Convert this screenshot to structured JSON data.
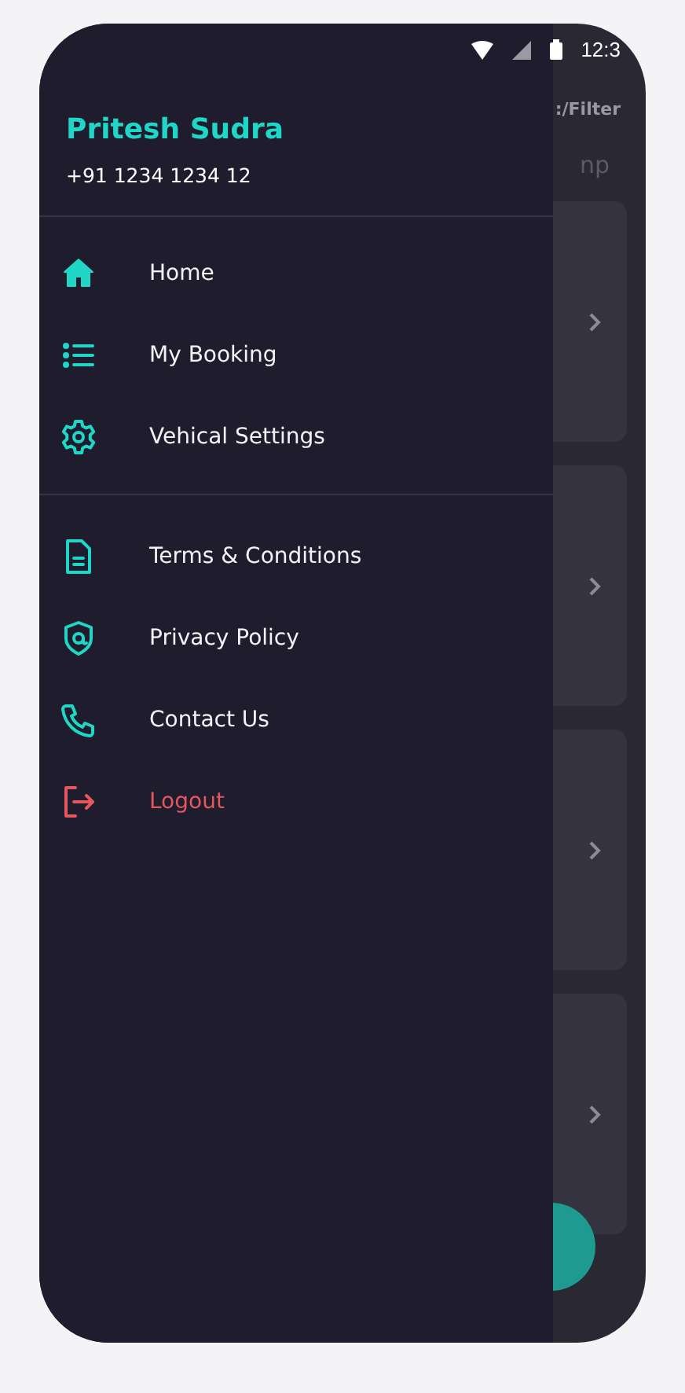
{
  "status_bar": {
    "time": "12:3"
  },
  "background": {
    "filter_label": ":/Filter",
    "subtitle": "np",
    "cards": [
      {
        "kind": "booking"
      },
      {
        "kind": "booking"
      },
      {
        "kind": "booking"
      },
      {
        "kind": "booking"
      }
    ]
  },
  "drawer": {
    "user": {
      "name": "Pritesh Sudra",
      "phone": "+91 1234 1234 12"
    },
    "sections": [
      {
        "items": [
          {
            "label": "Home",
            "kind": "normal"
          },
          {
            "label": "My Booking",
            "kind": "normal"
          },
          {
            "label": "Vehical Settings",
            "kind": "normal"
          }
        ]
      },
      {
        "items": [
          {
            "label": "Terms & Conditions",
            "kind": "normal"
          },
          {
            "label": "Privacy Policy",
            "kind": "normal"
          },
          {
            "label": "Contact Us",
            "kind": "normal"
          },
          {
            "label": "Logout",
            "kind": "danger"
          }
        ]
      }
    ]
  }
}
